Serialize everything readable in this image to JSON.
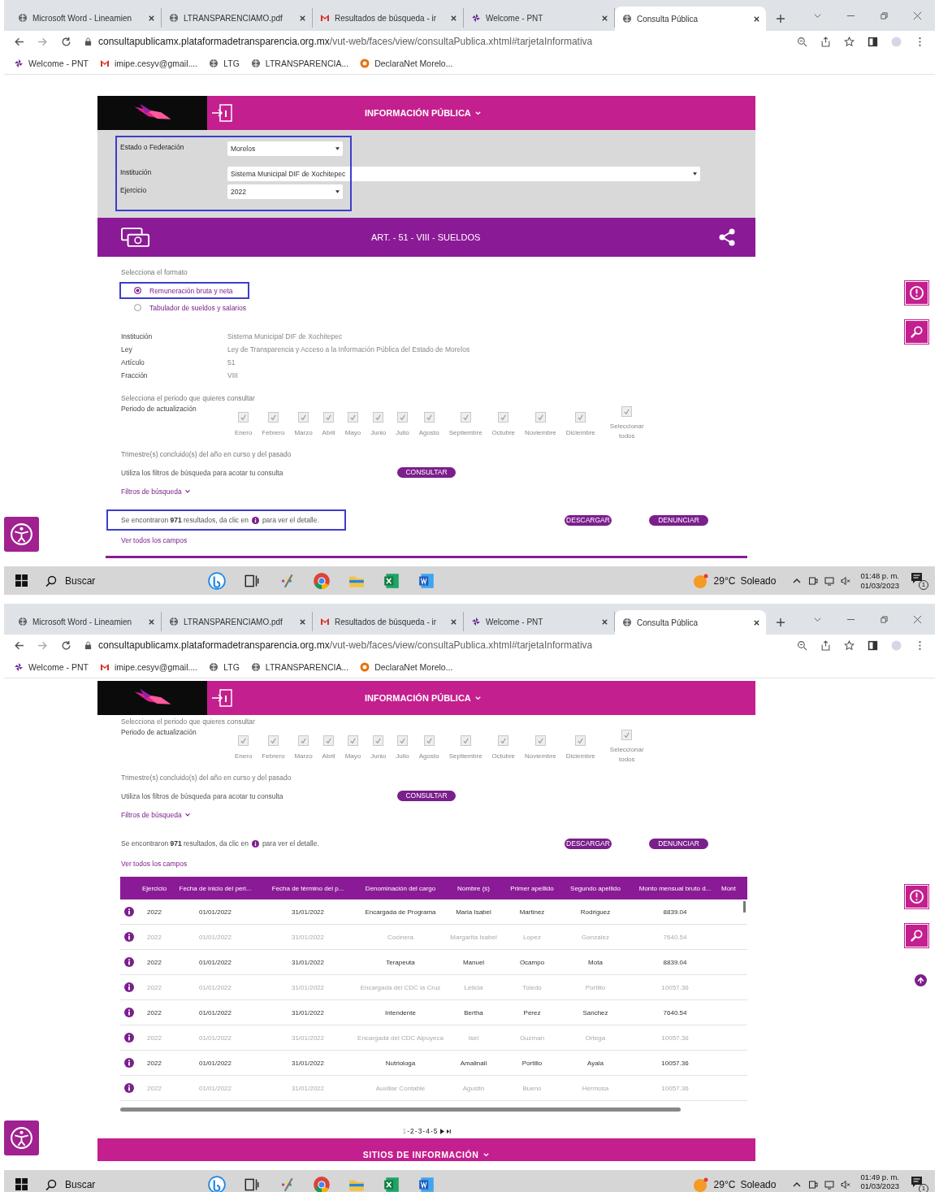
{
  "screens": [
    {
      "browser": {
        "tabs": [
          {
            "label": "Microsoft Word - Lineamien",
            "kind": "globe",
            "selected": false
          },
          {
            "label": "LTRANSPARENCIAMO.pdf",
            "kind": "globe",
            "selected": false
          },
          {
            "label": "Resultados de búsqueda - ir",
            "kind": "mail",
            "selected": false
          },
          {
            "label": "Welcome - PNT",
            "kind": "pinwheel",
            "selected": false
          },
          {
            "label": "Consulta Pública",
            "kind": "globe",
            "selected": true
          }
        ],
        "url_host": "consultapublicamx.plataformadetransparencia.org.mx",
        "url_path": "/vut-web/faces/view/consultaPublica.xhtml#tarjetaInformativa",
        "bookmarks": [
          {
            "label": "Welcome - PNT",
            "kind": "pinwheel"
          },
          {
            "label": "imipe.cesyv@gmail....",
            "kind": "mail"
          },
          {
            "label": "LTG",
            "kind": "globe"
          },
          {
            "label": "LTRANSPARENCIA...",
            "kind": "globe"
          },
          {
            "label": "DeclaraNet Morelo...",
            "kind": "ring"
          }
        ]
      },
      "page": {
        "sections": [
          {
            "kind": "header",
            "title": "INFORMACIÓN PÚBLICA"
          },
          {
            "kind": "filters",
            "highlighted": true,
            "fields": [
              {
                "label": "Estado o Federación",
                "value": "Morelos",
                "wide": false
              },
              {
                "label": "Institución",
                "value": "Sistema Municipal DIF de Xochitepec",
                "wide": true
              },
              {
                "label": "Ejercicio",
                "value": "2022",
                "wide": false
              }
            ]
          },
          {
            "kind": "banner",
            "title": "ART. - 51 - VIII - SUELDOS"
          },
          {
            "kind": "format",
            "label": "Selecciona el formato",
            "highlighted": true,
            "options": [
              {
                "label": "Remuneración bruta y neta",
                "selected": true
              },
              {
                "label": "Tabulador de sueldos y salarios",
                "selected": false
              }
            ]
          },
          {
            "kind": "info",
            "rows": [
              {
                "label": "Institución",
                "value": "Sistema Municipal DIF de Xochitepec"
              },
              {
                "label": "Ley",
                "value": "Ley de Transparencia y Acceso a la Información Pública del Estado de Morelos"
              },
              {
                "label": "Artículo",
                "value": "51"
              },
              {
                "label": "Fracción",
                "value": "VIII"
              }
            ]
          },
          {
            "kind": "period",
            "prompt": "Selecciona el periodo que quieres consultar",
            "label": "Periodo de actualización",
            "note": "Trimestre(s) concluido(s) del año en curso y del pasado",
            "months": [
              {
                "label": "Enero",
                "checked": true
              },
              {
                "label": "Febrero",
                "checked": true
              },
              {
                "label": "Marzo",
                "checked": true
              },
              {
                "label": "Abril",
                "checked": true
              },
              {
                "label": "Mayo",
                "checked": true
              },
              {
                "label": "Junio",
                "checked": true
              },
              {
                "label": "Julio",
                "checked": true
              },
              {
                "label": "Agosto",
                "checked": true
              },
              {
                "label": "Septiembre",
                "checked": true
              },
              {
                "label": "Octubre",
                "checked": true
              },
              {
                "label": "Noviembre",
                "checked": true
              },
              {
                "label": "Diciembre",
                "checked": true
              }
            ],
            "select_all": {
              "label": "Seleccionar todos",
              "checked": true
            }
          },
          {
            "kind": "query",
            "text": "Utiliza los filtros de búsqueda para acotar tu consulta",
            "button": "CONSULTAR",
            "filters_link": "Filtros de búsqueda"
          },
          {
            "kind": "results",
            "highlighted": true,
            "before": "Se encontraron **971** resultados, da clic en",
            "after": "para ver el detalle.",
            "buttons": [
              "DESCARGAR",
              "DENUNCIAR"
            ],
            "link": "Ver todos los campos"
          },
          {
            "kind": "table_top"
          }
        ]
      },
      "taskbar": {
        "search_placeholder": "Buscar",
        "temperature": "29°C",
        "weather": "Soleado",
        "time": "01:48 p. m.",
        "date": "01/03/2023",
        "notifications": "1"
      }
    },
    {
      "browser": {
        "tabs": [
          {
            "label": "Microsoft Word - Lineamien",
            "kind": "globe",
            "selected": false
          },
          {
            "label": "LTRANSPARENCIAMO.pdf",
            "kind": "globe",
            "selected": false
          },
          {
            "label": "Resultados de búsqueda - ir",
            "kind": "mail",
            "selected": false
          },
          {
            "label": "Welcome - PNT",
            "kind": "pinwheel",
            "selected": false
          },
          {
            "label": "Consulta Pública",
            "kind": "globe",
            "selected": true
          }
        ],
        "url_host": "consultapublicamx.plataformadetransparencia.org.mx",
        "url_path": "/vut-web/faces/view/consultaPublica.xhtml#tarjetaInformativa",
        "bookmarks": [
          {
            "label": "Welcome - PNT",
            "kind": "pinwheel"
          },
          {
            "label": "imipe.cesyv@gmail....",
            "kind": "mail"
          },
          {
            "label": "LTG",
            "kind": "globe"
          },
          {
            "label": "LTRANSPARENCIA...",
            "kind": "globe"
          },
          {
            "label": "DeclaraNet Morelo...",
            "kind": "ring"
          }
        ]
      },
      "page": {
        "scroll_top_button": true,
        "sections": [
          {
            "kind": "header",
            "title": "INFORMACIÓN PÚBLICA"
          },
          {
            "kind": "period",
            "prompt": "Selecciona el periodo que quieres consultar",
            "label": "Periodo de actualización",
            "note": "Trimestre(s) concluido(s) del año en curso y del pasado",
            "months": [
              {
                "label": "Enero",
                "checked": true
              },
              {
                "label": "Febrero",
                "checked": true
              },
              {
                "label": "Marzo",
                "checked": true
              },
              {
                "label": "Abril",
                "checked": true
              },
              {
                "label": "Mayo",
                "checked": true
              },
              {
                "label": "Junio",
                "checked": true
              },
              {
                "label": "Julio",
                "checked": true
              },
              {
                "label": "Agosto",
                "checked": true
              },
              {
                "label": "Septiembre",
                "checked": true
              },
              {
                "label": "Octubre",
                "checked": true
              },
              {
                "label": "Noviembre",
                "checked": true
              },
              {
                "label": "Diciembre",
                "checked": true
              }
            ],
            "select_all": {
              "label": "Seleccionar todos",
              "checked": true
            }
          },
          {
            "kind": "query",
            "text": "Utiliza los filtros de búsqueda para acotar tu consulta",
            "button": "CONSULTAR",
            "filters_link": "Filtros de búsqueda"
          },
          {
            "kind": "results",
            "before": "Se encontraron **971** resultados, da clic en",
            "after": "para ver el detalle.",
            "buttons": [
              "DESCARGAR",
              "DENUNCIAR"
            ],
            "link": "Ver todos los campos"
          },
          {
            "kind": "table",
            "columns": [
              "Ejercicio",
              "Fecha de inicio del peri...",
              "Fecha de término del p...",
              "Denominación del cargo",
              "Nombre (s)",
              "Primer apellido",
              "Segundo apellido",
              "Monto mensual bruto d...",
              "Mont"
            ],
            "rows": [
              [
                "2022",
                "01/01/2022",
                "31/01/2022",
                "Encargada de Programa",
                "Maria Isabel",
                "Martinez",
                "Rodriguez",
                "8839.04"
              ],
              [
                "2022",
                "01/01/2022",
                "31/01/2022",
                "Cocinera",
                "Margarita Isabel",
                "Lopez",
                "Gonzalez",
                "7640.54"
              ],
              [
                "2022",
                "01/01/2022",
                "31/01/2022",
                "Terapeuta",
                "Manuel",
                "Ocampo",
                "Mota",
                "8839.04"
              ],
              [
                "2022",
                "01/01/2022",
                "31/01/2022",
                "Encargada del CDC la Cruz",
                "Leticia",
                "Toledo",
                "Portillo",
                "10057.36"
              ],
              [
                "2022",
                "01/01/2022",
                "31/01/2022",
                "Intendente",
                "Bertha",
                "Perez",
                "Sanchez",
                "7640.54"
              ],
              [
                "2022",
                "01/01/2022",
                "31/01/2022",
                "Encargada del CDC Alpuyeca",
                "Isel",
                "Guzman",
                "Ortega",
                "10057.36"
              ],
              [
                "2022",
                "01/01/2022",
                "31/01/2022",
                "Nutriologa",
                "Amalinali",
                "Portillo",
                "Ayala",
                "10057.36"
              ],
              [
                "2022",
                "01/01/2022",
                "31/01/2022",
                "Auxiliar Contable",
                "Agustin",
                "Bueno",
                "Hermosa",
                "10057.36"
              ]
            ]
          },
          {
            "kind": "pagination",
            "separator": "-",
            "pages": [
              {
                "label": "1",
                "selected": true
              },
              {
                "label": "2",
                "selected": false
              },
              {
                "label": "3",
                "selected": false
              },
              {
                "label": "4",
                "selected": false
              },
              {
                "label": "5",
                "selected": false
              }
            ]
          },
          {
            "kind": "footer",
            "title": "SITIOS DE INFORMACIÓN"
          }
        ]
      },
      "taskbar": {
        "search_placeholder": "Buscar",
        "temperature": "29°C",
        "weather": "Soleado",
        "time": "01:49 p. m.",
        "date": "01/03/2023",
        "notifications": "1"
      }
    }
  ]
}
